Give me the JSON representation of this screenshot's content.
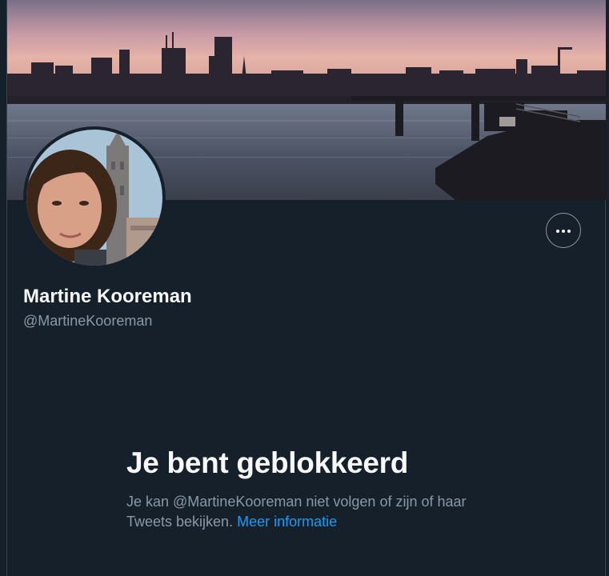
{
  "profile": {
    "name": "Martine Kooreman",
    "handle": "@MartineKooreman"
  },
  "blocked": {
    "title": "Je bent geblokkeerd",
    "line1": "Je kan @MartineKooreman niet volgen of zijn of haar",
    "line2": "Tweets bekijken.",
    "link": "Meer informatie"
  },
  "icons": {
    "more": "more-horizontal-icon"
  },
  "colors": {
    "background": "#15202b",
    "text_primary": "#f7f9f9",
    "text_secondary": "#8b98a5",
    "link": "#1d9bf0"
  }
}
